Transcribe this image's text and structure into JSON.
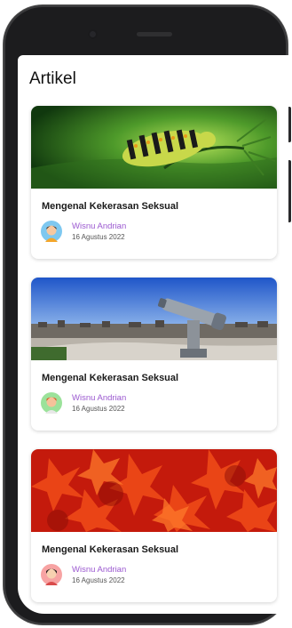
{
  "page": {
    "title": "Artikel"
  },
  "articles": [
    {
      "title": "Mengenal Kekerasan Seksual",
      "author": "Wisnu Andrian",
      "date": "16 Agustus 2022",
      "image_icon": "caterpillar-image",
      "avatar_icon": "avatar-blue-icon"
    },
    {
      "title": "Mengenal Kekerasan Seksual",
      "author": "Wisnu Andrian",
      "date": "16 Agustus 2022",
      "image_icon": "telescope-image",
      "avatar_icon": "avatar-green-icon"
    },
    {
      "title": "Mengenal Kekerasan Seksual",
      "author": "Wisnu Andrian",
      "date": "16 Agustus 2022",
      "image_icon": "red-leaves-image",
      "avatar_icon": "avatar-pink-icon"
    }
  ],
  "colors": {
    "author": "#9b59d0",
    "frame": "#1c1c1e",
    "background": "#ffffff"
  }
}
